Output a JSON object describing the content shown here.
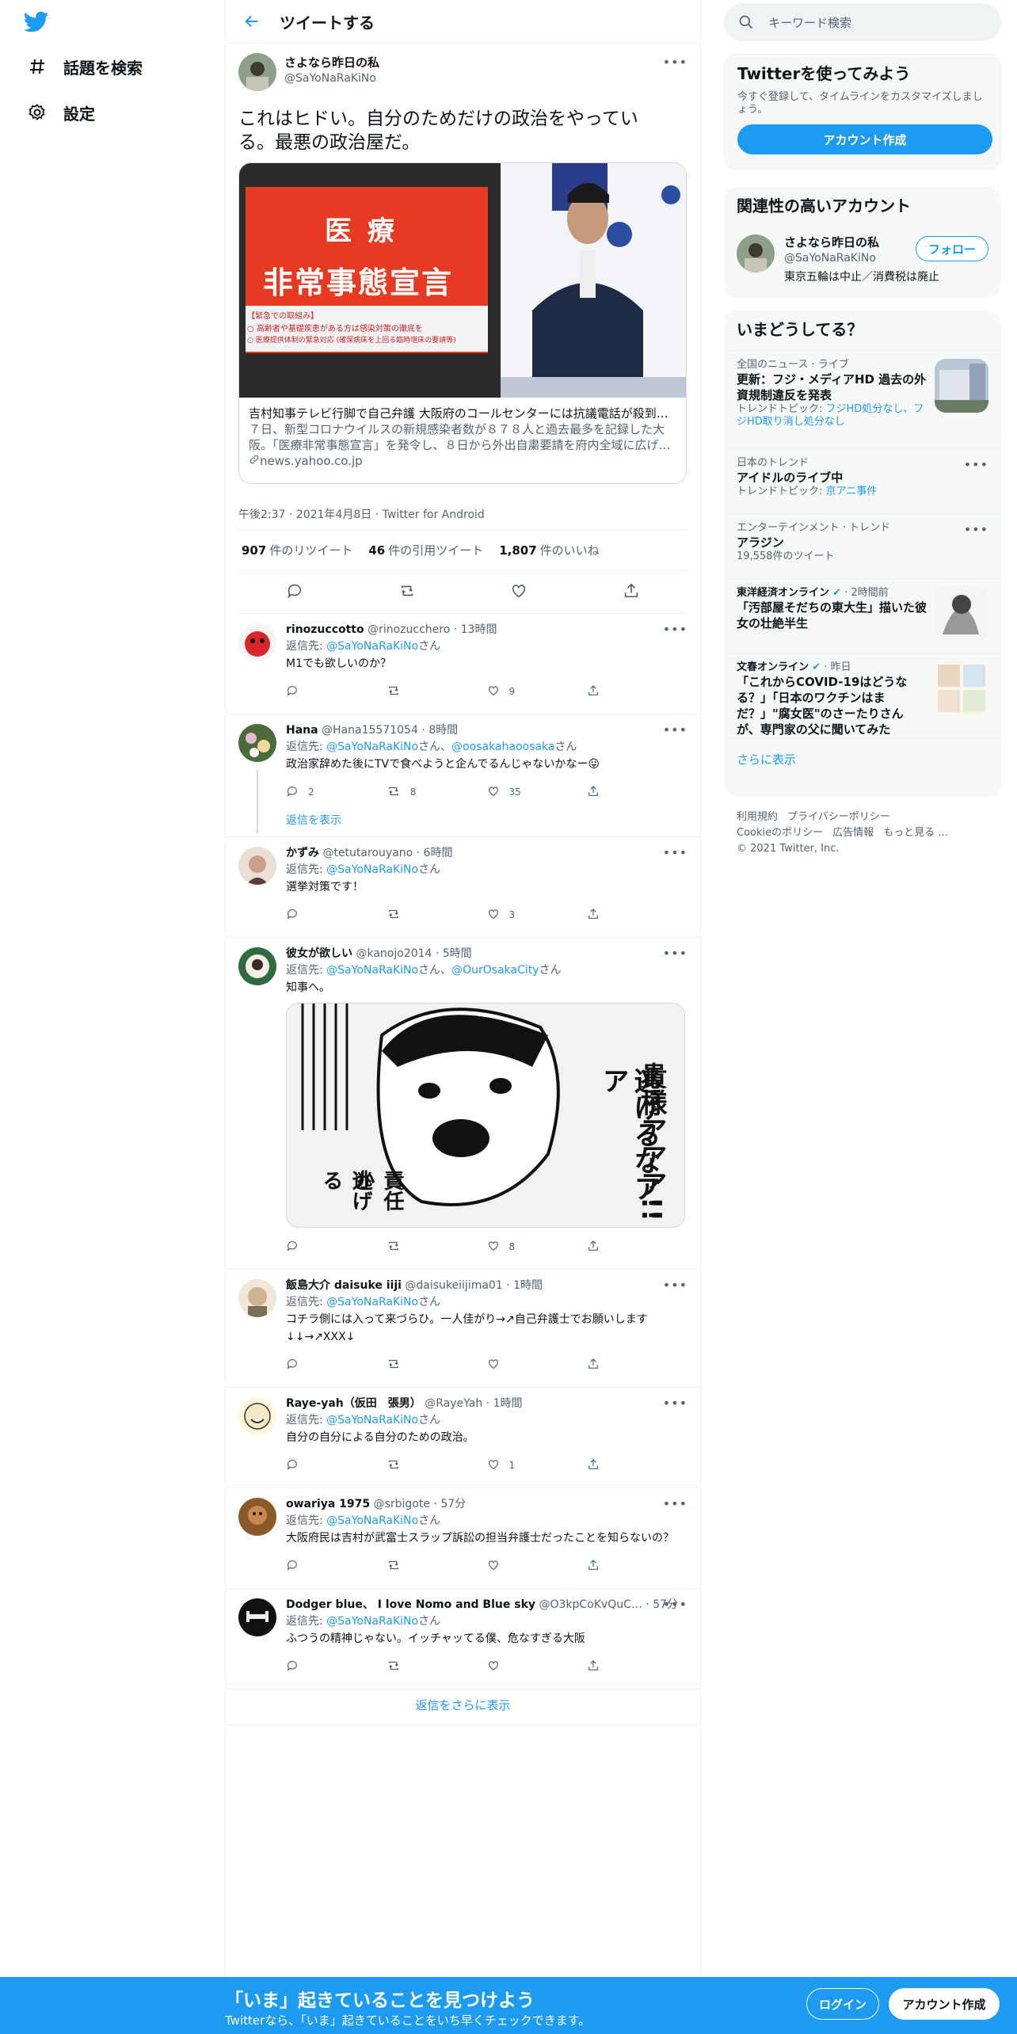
{
  "nav": {
    "logo_icon": "twitter-bird-icon",
    "explore_label": "話題を検索",
    "settings_label": "設定"
  },
  "header": {
    "title": "ツイートする"
  },
  "main_tweet": {
    "name": "さよなら昨日の私",
    "handle": "@SaYoNaRaKiNo",
    "text": "これはヒドい。自分のためだけの政治をやっている。最悪の政治屋だ。",
    "card": {
      "image_text_1": "医 療",
      "image_text_2": "非常事態宣言",
      "image_text_3": "【緊急での取組み】",
      "image_text_4": "○ 高齢者や基礎疾患がある方は感染対策の徹底を",
      "image_text_5": "○ 医療提供体制の緊急対応 (確保病床を上回る臨時増床の要請等)",
      "title": "吉村知事テレビ行脚で自己弁護 大阪府のコールセンターには抗議電話が殺到…",
      "desc": "７日、新型コロナウイルスの新規感染者数が８７８人と過去最多を記録した大阪。「医療非常事態宣言」を発令し、８日から外出自粛要請を府内全域に広げ…",
      "link": "news.yahoo.co.jp"
    },
    "meta": "午後2:37 · 2021年4月8日 · Twitter for Android",
    "retweets": "907",
    "retweets_label": "件のリツイート",
    "quotes": "46",
    "quotes_label": "件の引用ツイート",
    "likes": "1,807",
    "likes_label": "件のいいね"
  },
  "replies": [
    {
      "name": "rinozuccotto",
      "handle": "@rinozucchero",
      "time": "· 13時間",
      "to_label": "返信先:",
      "to": "@SaYoNaRaKiNo",
      "to_suffix": "さん",
      "text": "M1でも欲しいのか？",
      "likes": "9"
    },
    {
      "name": "Hana",
      "handle": "@Hana15571054",
      "time": "· 8時間",
      "to_label": "返信先:",
      "to": "@SaYoNaRaKiNo",
      "to_mid": "さん、",
      "to2": "@oosakahaoosaka",
      "to_suffix": "さん",
      "text": "政治家辞めた後にTVで食べようと企んでるんじゃないかなー😛",
      "replies": "2",
      "retweets": "8",
      "likes": "35",
      "show_replies": "返信を表示"
    },
    {
      "name": "かずみ",
      "handle": "@tetutarouyano",
      "time": "· 6時間",
      "to_label": "返信先:",
      "to": "@SaYoNaRaKiNo",
      "to_suffix": "さん",
      "text": "選挙対策です！",
      "likes": "3"
    },
    {
      "name": "彼女が欲しい",
      "handle": "@kanojo2014",
      "time": "· 5時間",
      "to_label": "返信先:",
      "to": "@SaYoNaRaKiNo",
      "to_mid": "さん、",
      "to2": "@OurOsakaCity",
      "to_suffix": "さん",
      "text": "知事へ。",
      "likes": "8",
      "image_text_1": "貴様アアア!!",
      "image_text_2": "逃げるなアア",
      "image_text_3": "責任か",
      "image_text_4": "逃げる"
    },
    {
      "name": "飯島大介 daisuke iiji",
      "handle": "@daisukeiijima01",
      "time": "· 1時間",
      "to_label": "返信先:",
      "to": "@SaYoNaRaKiNo",
      "to_suffix": "さん",
      "text": "コチラ側には入って来づらひ。一人佳がり→↗自己弁護士でお願いします↓↓→↗XXX↓"
    },
    {
      "name": "Raye-yah（仮田　張男）",
      "handle": "@RayeYah",
      "time": "· 1時間",
      "to_label": "返信先:",
      "to": "@SaYoNaRaKiNo",
      "to_suffix": "さん",
      "text": "自分の自分による自分のための政治。",
      "likes": "1"
    },
    {
      "name": "owariya 1975",
      "handle": "@srbigote",
      "time": "· 57分",
      "to_label": "返信先:",
      "to": "@SaYoNaRaKiNo",
      "to_suffix": "さん",
      "text": "大阪府民は吉村が武富士スラップ訴訟の担当弁護士だったことを知らないの？"
    },
    {
      "name": "Dodger blue、 I love Nomo and Blue sky",
      "handle": "@O3kpCoKvQuC…",
      "time": "· 57分",
      "to_label": "返信先:",
      "to": "@SaYoNaRaKiNo",
      "to_suffix": "さん",
      "text": "ふつうの精神じゃない。イッチャッてる僕、危なすぎる大阪"
    }
  ],
  "show_more_replies": "返信をさらに表示",
  "right": {
    "search_placeholder": "キーワード検索",
    "signup_title": "Twitterを使ってみよう",
    "signup_sub": "今すぐ登録して、タイムラインをカスタマイズしましょう。",
    "signup_button": "アカウント作成",
    "related_title": "関連性の高いアカウント",
    "related_name": "さよなら昨日の私",
    "related_handle": "@SaYoNaRaKiNo",
    "related_bio": "東京五輪は中止／消費税は廃止",
    "follow_button": "フォロー",
    "trends_title": "いまどうしてる？",
    "trends": [
      {
        "ctx": "全国のニュース · ライブ",
        "name": "更新：フジ・メディアHD 過去の外資規制違反を発表",
        "sub_label": "トレンドトピック:",
        "sub": "フジHD処分なし、フジHD取り消し処分なし"
      },
      {
        "ctx": "日本のトレンド",
        "name": "アイドルのライブ中",
        "sub_label": "トレンドトピック:",
        "sub": "京アニ事件"
      },
      {
        "ctx": "エンターテインメント · トレンド",
        "name": "アラジン",
        "sub_label": "",
        "sub": "19,558件のツイート"
      },
      {
        "ctx": "東洋経済オンライン",
        "ctx_time": "· 2時間前",
        "name": "「汚部屋そだちの東大生」描いた彼女の壮絶半生"
      },
      {
        "ctx": "文春オンライン",
        "ctx_time": "· 昨日",
        "name": "「これからCOVID-19はどうなる？」「日本のワクチンはまだ？」\"腐女医\"のさーたりさんが、専門家の父に聞いてみた"
      }
    ],
    "show_more": "さらに表示",
    "footer_1": "利用規約",
    "footer_2": "プライバシーポリシー",
    "footer_3": "Cookieのポリシー",
    "footer_4": "広告情報",
    "footer_5": "もっと見る …",
    "footer_6": "© 2021 Twitter, Inc."
  },
  "bottom": {
    "title": "「いま」起きていることを見つけよう",
    "sub": "Twitterなら、「いま」起きていることをいち早くチェックできます。",
    "login": "ログイン",
    "signup": "アカウント作成"
  },
  "colors": {
    "accent": "#1d9bf0",
    "text": "#0f1419",
    "secondary": "#536471"
  }
}
